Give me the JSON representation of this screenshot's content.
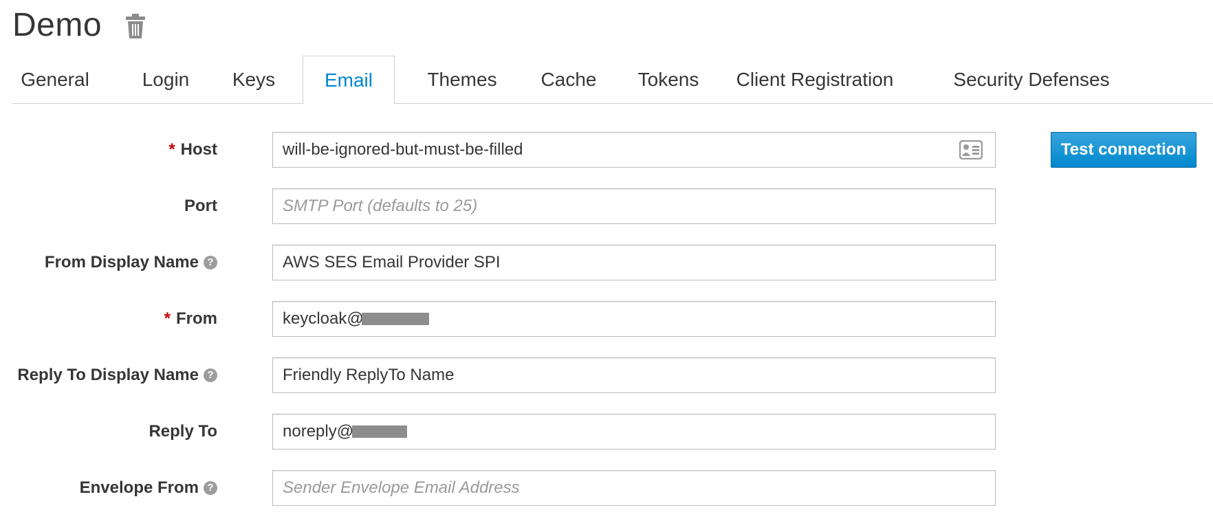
{
  "page": {
    "title": "Demo"
  },
  "tabs": [
    {
      "label": "General"
    },
    {
      "label": "Login"
    },
    {
      "label": "Keys"
    },
    {
      "label": "Email",
      "active": true
    },
    {
      "label": "Themes"
    },
    {
      "label": "Cache"
    },
    {
      "label": "Tokens"
    },
    {
      "label": "Client Registration"
    },
    {
      "label": "Security Defenses"
    }
  ],
  "form": {
    "host": {
      "label": "Host",
      "required": true,
      "value": "will-be-ignored-but-must-be-filled",
      "placeholder": ""
    },
    "port": {
      "label": "Port",
      "value": "",
      "placeholder": "SMTP Port (defaults to 25)"
    },
    "from_display_name": {
      "label": "From Display Name",
      "value": "AWS SES Email Provider SPI",
      "placeholder": ""
    },
    "from": {
      "label": "From",
      "required": true,
      "value": "keycloak@",
      "placeholder": ""
    },
    "reply_to_display_name": {
      "label": "Reply To Display Name",
      "value": "Friendly ReplyTo Name",
      "placeholder": ""
    },
    "reply_to": {
      "label": "Reply To",
      "value": "noreply@",
      "placeholder": ""
    },
    "envelope_from": {
      "label": "Envelope From",
      "value": "",
      "placeholder": "Sender Envelope Email Address"
    }
  },
  "actions": {
    "test_connection": "Test connection"
  },
  "icons": {
    "delete": "trash-icon",
    "help": "question-circle-icon",
    "autofill": "contact-card-icon"
  },
  "colors": {
    "accent": "#0088ce",
    "required": "#cc0000",
    "button": "#0088ce"
  }
}
